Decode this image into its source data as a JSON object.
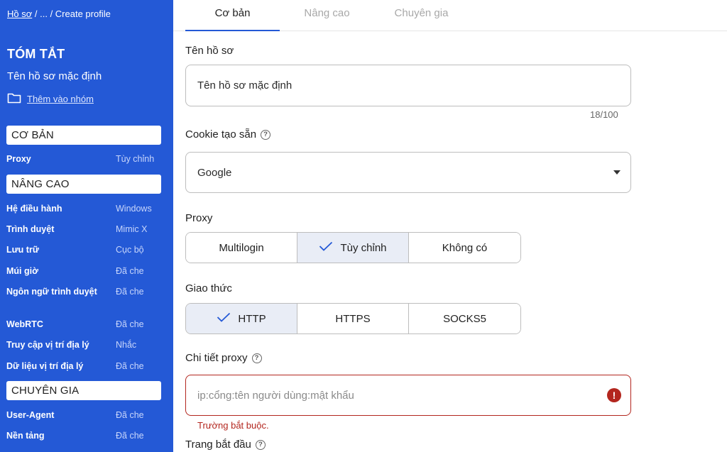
{
  "breadcrumb": {
    "home": "Hồ sơ",
    "sep1": " / ",
    "ellipsis": "...",
    "sep2": " / ",
    "current": "Create profile"
  },
  "sidebar": {
    "summary_title": "TÓM TẮT",
    "profile_name": "Tên hồ sơ mặc định",
    "add_group": "Thêm vào nhóm",
    "sections": {
      "basic": {
        "title": "CƠ BẢN",
        "rows": [
          {
            "key": "Proxy",
            "value": "Tùy chỉnh"
          }
        ]
      },
      "advanced": {
        "title": "NÂNG CAO",
        "rows": [
          {
            "key": "Hệ điều hành",
            "value": "Windows"
          },
          {
            "key": "Trình duyệt",
            "value": "Mimic X"
          },
          {
            "key": "Lưu trữ",
            "value": "Cục bộ"
          },
          {
            "key": "Múi giờ",
            "value": "Đã che"
          },
          {
            "key": "Ngôn ngữ trình duyệt",
            "value": "Đã che"
          },
          {
            "key": "WebRTC",
            "value": "Đã che"
          },
          {
            "key": "Truy cập vị trí địa lý",
            "value": "Nhắc"
          },
          {
            "key": "Dữ liệu vị trí địa lý",
            "value": "Đã che"
          }
        ]
      },
      "expert": {
        "title": "CHUYÊN GIA",
        "rows": [
          {
            "key": "User-Agent",
            "value": "Đã che"
          },
          {
            "key": "Nền tảng",
            "value": "Đã che"
          }
        ]
      }
    }
  },
  "tabs": [
    {
      "label": "Cơ bản",
      "active": true
    },
    {
      "label": "Nâng cao",
      "active": false
    },
    {
      "label": "Chuyên gia",
      "active": false
    }
  ],
  "form": {
    "profile_name": {
      "label": "Tên hồ sơ",
      "value": "Tên hồ sơ mặc định",
      "counter": "18/100"
    },
    "cookie": {
      "label": "Cookie tạo sẵn",
      "help": "?",
      "value": "Google"
    },
    "proxy": {
      "label": "Proxy",
      "options": [
        "Multilogin",
        "Tùy chỉnh",
        "Không có"
      ],
      "selected": "Tùy chỉnh"
    },
    "protocol": {
      "label": "Giao thức",
      "options": [
        "HTTP",
        "HTTPS",
        "SOCKS5"
      ],
      "selected": "HTTP"
    },
    "proxy_details": {
      "label": "Chi tiết proxy",
      "help": "?",
      "placeholder": "ip:cổng:tên người dùng:mật khẩu",
      "error": "Trường bắt buộc.",
      "error_icon": "!"
    },
    "start_page": {
      "label": "Trang bắt đầu",
      "help": "?"
    }
  },
  "colors": {
    "sidebar_bg": "#2459d6",
    "accent": "#2459d6",
    "error": "#b3261e",
    "selected_seg": "#e9edf6"
  },
  "icons": {
    "folder": "folder-icon",
    "help": "help-circle-icon",
    "dropdown": "caret-down-icon",
    "check": "check-icon",
    "error": "error-circle-icon"
  }
}
